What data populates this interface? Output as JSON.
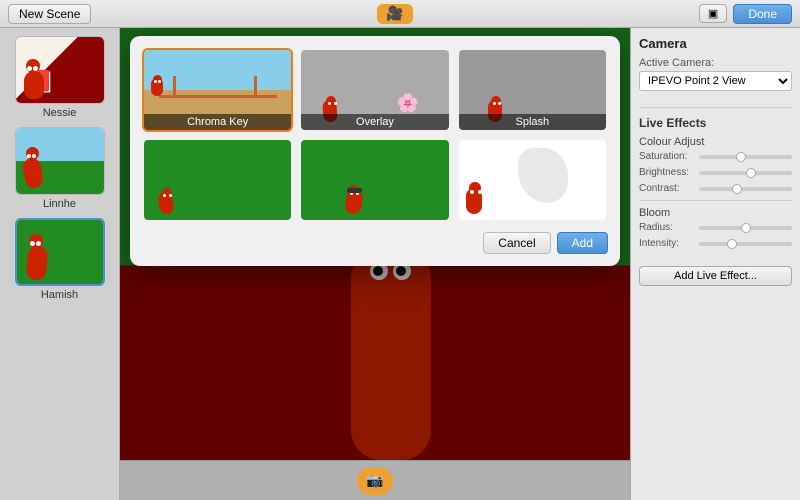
{
  "topBar": {
    "newSceneLabel": "New Scene",
    "doneLabel": "Done",
    "windowToggleLabel": "⊞"
  },
  "sidebar": {
    "items": [
      {
        "label": "Nessie",
        "selected": false
      },
      {
        "label": "Linnhe",
        "selected": false
      },
      {
        "label": "Hamish",
        "selected": true
      }
    ]
  },
  "modal": {
    "effects": [
      {
        "id": "chroma-key",
        "label": "Chroma Key",
        "selected": true,
        "bgType": "chroma"
      },
      {
        "id": "overlay",
        "label": "Overlay",
        "selected": false,
        "bgType": "overlay"
      },
      {
        "id": "splash",
        "label": "Splash",
        "selected": false,
        "bgType": "splash"
      },
      {
        "id": "green1",
        "label": "",
        "selected": false,
        "bgType": "green"
      },
      {
        "id": "green2",
        "label": "",
        "selected": false,
        "bgType": "green2"
      },
      {
        "id": "green3",
        "label": "",
        "selected": false,
        "bgType": "greenwhite"
      }
    ],
    "cancelLabel": "Cancel",
    "addLabel": "Add"
  },
  "rightPanel": {
    "cameraTitle": "Camera",
    "activeCameraLabel": "Active Camera:",
    "activeCameraValue": "IPEVO Point 2 View",
    "liveEffectsTitle": "Live Effects",
    "colourAdjustTitle": "Colour Adjust",
    "saturationLabel": "Saturation:",
    "brightnessLabel": "Brightness:",
    "contrastLabel": "Contrast:",
    "bloomTitle": "Bloom",
    "radiusLabel": "Radius:",
    "intensityLabel": "Intensity:",
    "addEffectLabel": "Add Live Effect..."
  }
}
